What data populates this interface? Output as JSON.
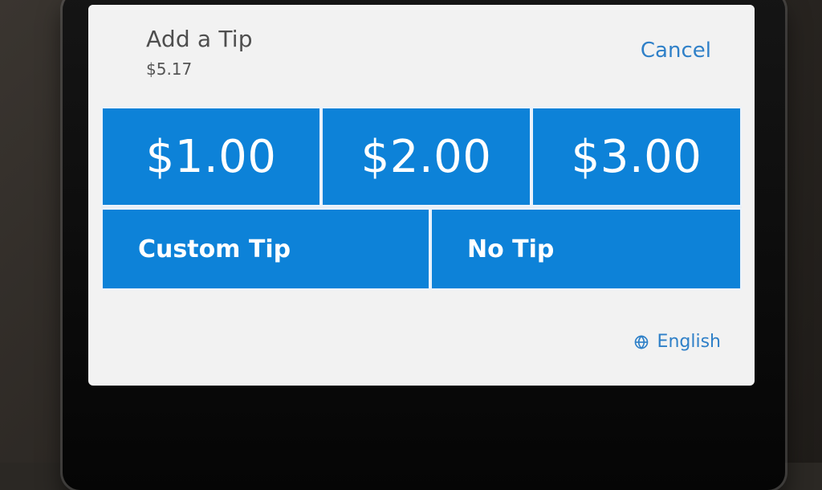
{
  "screen": {
    "title": "Add a Tip",
    "amount": "$5.17",
    "cancel_label": "Cancel",
    "tips": [
      {
        "label": "$1.00"
      },
      {
        "label": "$2.00"
      },
      {
        "label": "$3.00"
      },
      {
        "label": "Custom Tip"
      },
      {
        "label": "No Tip"
      }
    ],
    "language_label": "English",
    "icons": {
      "language": "globe-icon"
    },
    "colors": {
      "accent": "#0d82d8",
      "link": "#2f80c8",
      "background": "#f2f2f2"
    }
  }
}
